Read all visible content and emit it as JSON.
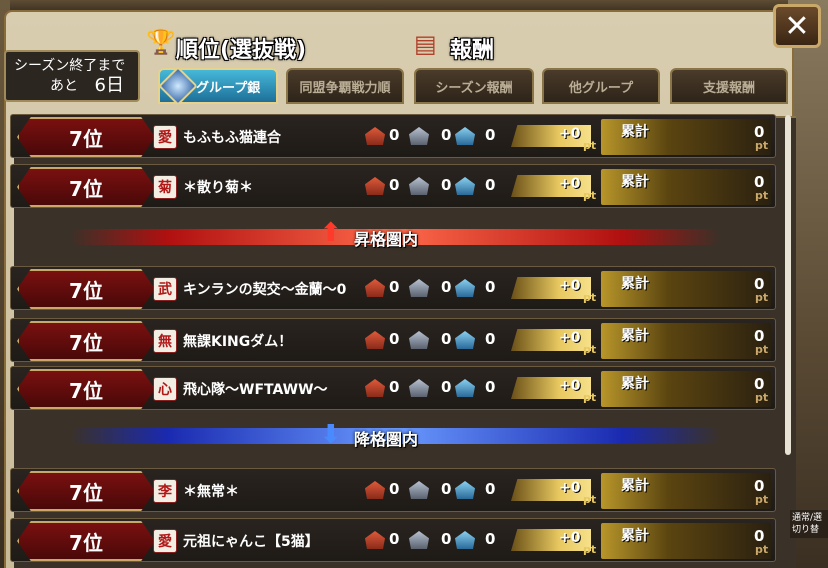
{
  "header": {
    "ranking_title": "順位(選抜戦)",
    "rewards_title": "報酬",
    "trophy_icon": "trophy-icon",
    "chest_icon": "treasure-chest-icon"
  },
  "season": {
    "label": "シーズン終了まで",
    "prefix": "あと",
    "days": "6日"
  },
  "close_label": "✕",
  "tabs": [
    {
      "label": "グループ銀",
      "active": true
    },
    {
      "label": "同盟争覇戦力順",
      "active": false
    },
    {
      "label": "シーズン報酬",
      "active": false
    },
    {
      "label": "他グループ",
      "active": false
    },
    {
      "label": "支援報酬",
      "active": false
    }
  ],
  "promotion_label": "昇格圏内",
  "demotion_label": "降格圏内",
  "sum_label": "累計",
  "pt_unit": "pt",
  "rows": [
    {
      "rank": "7位",
      "crest": "愛",
      "name": "もふもふ猫連合",
      "s1": "0",
      "s2": "0",
      "s3": "0",
      "pt": "+0",
      "sum": "0"
    },
    {
      "rank": "7位",
      "crest": "菊",
      "name": "＊散り菊＊",
      "s1": "0",
      "s2": "0",
      "s3": "0",
      "pt": "+0",
      "sum": "0"
    },
    {
      "rank": "7位",
      "crest": "武",
      "name": "キンランの契交～金蘭～0",
      "s1": "0",
      "s2": "0",
      "s3": "0",
      "pt": "+0",
      "sum": "0"
    },
    {
      "rank": "7位",
      "crest": "無",
      "name": "無課KINGダム！",
      "s1": "0",
      "s2": "0",
      "s3": "0",
      "pt": "+0",
      "sum": "0"
    },
    {
      "rank": "7位",
      "crest": "心",
      "name": "飛心隊～WFTAWW～",
      "s1": "0",
      "s2": "0",
      "s3": "0",
      "pt": "+0",
      "sum": "0"
    },
    {
      "rank": "7位",
      "crest": "李",
      "name": "＊無常＊",
      "s1": "0",
      "s2": "0",
      "s3": "0",
      "pt": "+0",
      "sum": "0"
    },
    {
      "rank": "7位",
      "crest": "愛",
      "name": "元祖にゃんこ【5猫】",
      "s1": "0",
      "s2": "0",
      "s3": "0",
      "pt": "+0",
      "sum": "0"
    }
  ],
  "side_note": "通常/選 切り替"
}
